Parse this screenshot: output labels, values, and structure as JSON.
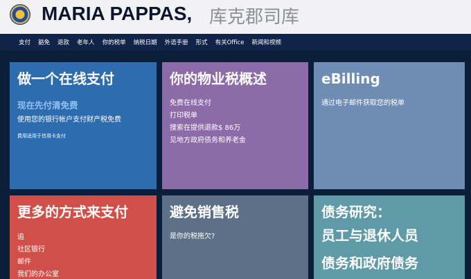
{
  "header": {
    "title": "MARIA PAPPAS,",
    "subtitle": "库克郡司库"
  },
  "nav": {
    "items": [
      "支付",
      "豁免",
      "退款",
      "老年人",
      "你的税单",
      "纳税日期",
      "外语手册",
      "形式",
      "有关Office",
      "新闻和视频"
    ]
  },
  "cards": {
    "pay_online": {
      "title": "做一个在线支付",
      "subtitle": "现在先付清免费",
      "description": "使用您的银行帐户支付财产税免费",
      "note": "费用适用于信用卡支付"
    },
    "overview": {
      "title": "你的物业税概述",
      "links": [
        "免费在线支付",
        "打印税单",
        "搜索在提供退款$ 86万",
        "见地方政府债务和养老金"
      ]
    },
    "ebilling": {
      "title": "eBilling",
      "description": "通过电子邮件获取您的税单"
    },
    "more_ways": {
      "title": "更多的方式来支付",
      "links": [
        "追",
        "社区银行",
        "邮件",
        "我们的办公室"
      ]
    },
    "avoid_sale": {
      "title": "避免销售税",
      "description": "是你的税拖欠?"
    },
    "debt_study": {
      "title": "债务研究：",
      "line2": "员工与退休人员",
      "line3": "债务和政府债务"
    }
  }
}
